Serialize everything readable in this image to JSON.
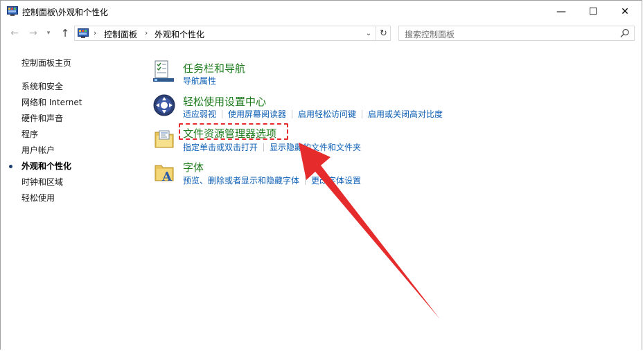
{
  "window": {
    "title": "控制面板\\外观和个性化",
    "minimize": "—",
    "maximize": "☐",
    "close": "✕"
  },
  "address": {
    "breadcrumbs": [
      "控制面板",
      "外观和个性化"
    ],
    "search_placeholder": "搜索控制面板"
  },
  "sidebar": {
    "home": "控制面板主页",
    "items": [
      {
        "label": "系统和安全",
        "active": false
      },
      {
        "label": "网络和 Internet",
        "active": false
      },
      {
        "label": "硬件和声音",
        "active": false
      },
      {
        "label": "程序",
        "active": false
      },
      {
        "label": "用户帐户",
        "active": false
      },
      {
        "label": "外观和个性化",
        "active": true
      },
      {
        "label": "时钟和区域",
        "active": false
      },
      {
        "label": "轻松使用",
        "active": false
      }
    ]
  },
  "categories": [
    {
      "title": "任务栏和导航",
      "icon": "taskbar-icon",
      "links": [
        "导航属性"
      ]
    },
    {
      "title": "轻松使用设置中心",
      "icon": "ease-of-access-icon",
      "links": [
        "适应弱视",
        "使用屏幕阅读器",
        "启用轻松访问键",
        "启用或关闭高对比度"
      ]
    },
    {
      "title": "文件资源管理器选项",
      "icon": "folder-options-icon",
      "links": [
        "指定单击或双击打开",
        "显示隐藏的文件和文件夹"
      ]
    },
    {
      "title": "字体",
      "icon": "fonts-folder-icon",
      "links": [
        "预览、删除或者显示和隐藏字体",
        "更改字体设置"
      ]
    }
  ],
  "colors": {
    "category_title": "#1e7c1e",
    "link": "#0d5fb5",
    "annotation": "#e52b2b"
  }
}
